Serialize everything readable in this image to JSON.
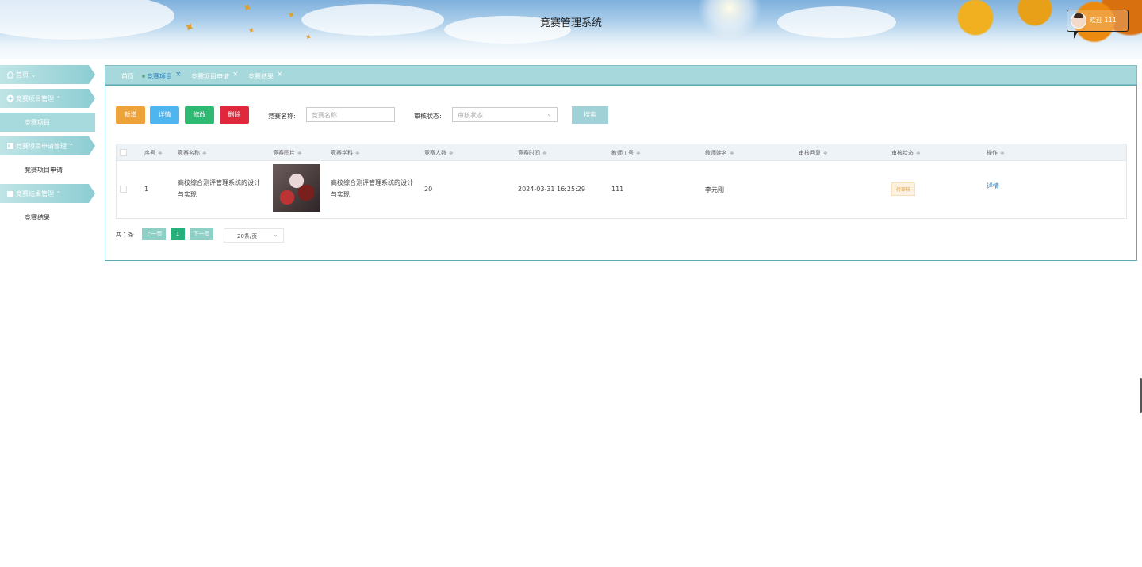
{
  "header": {
    "title": "竞赛管理系统",
    "welcome": "欢迎 111"
  },
  "sidebar": {
    "items": [
      {
        "label": "首页",
        "caret": "⌄"
      },
      {
        "label": "竞赛项目管理",
        "caret": "⌃"
      },
      {
        "label": "竞赛项目"
      },
      {
        "label": "竞赛项目申请管理",
        "caret": "⌃"
      },
      {
        "label": "竞赛项目申请"
      },
      {
        "label": "竞赛结果管理",
        "caret": "⌃"
      },
      {
        "label": "竞赛结果"
      }
    ]
  },
  "tabs": [
    {
      "label": "首页"
    },
    {
      "label": "竞赛项目",
      "close": "×"
    },
    {
      "label": "竞赛项目申请",
      "close": "×"
    },
    {
      "label": "竞赛结果",
      "close": "×"
    }
  ],
  "toolbar": {
    "add": "新增",
    "detail": "详情",
    "edit": "修改",
    "delete": "删除",
    "name_label": "竞赛名称:",
    "name_placeholder": "竞赛名称",
    "status_label": "审核状态:",
    "status_placeholder": "审核状态",
    "search": "搜索"
  },
  "table": {
    "headers": [
      "序号",
      "竞赛名称",
      "竞赛图片",
      "竞赛学科",
      "竞赛人数",
      "竞赛时间",
      "教师工号",
      "教师姓名",
      "审核回复",
      "审核状态",
      "操作"
    ],
    "rows": [
      {
        "index": "1",
        "name_line1": "高校综合测评管理系统的设计",
        "name_line2": "与实现",
        "subject_line1": "高校综合测评管理系统的设计",
        "subject_line2": "与实现",
        "count": "20",
        "time": "2024-03-31 16:25:29",
        "teacher_id": "111",
        "teacher_name": "李元刚",
        "reply": "",
        "status": "待审核",
        "action": "详情"
      }
    ]
  },
  "pagination": {
    "total": "共 1 条",
    "prev": "上一页",
    "page": "1",
    "next": "下一页",
    "page_size": "20条/页"
  },
  "colors": {
    "primary": "#a6d8dc",
    "add": "#eea23a",
    "detail": "#4fb5ef",
    "edit": "#2fba74",
    "delete": "#e0283c"
  }
}
